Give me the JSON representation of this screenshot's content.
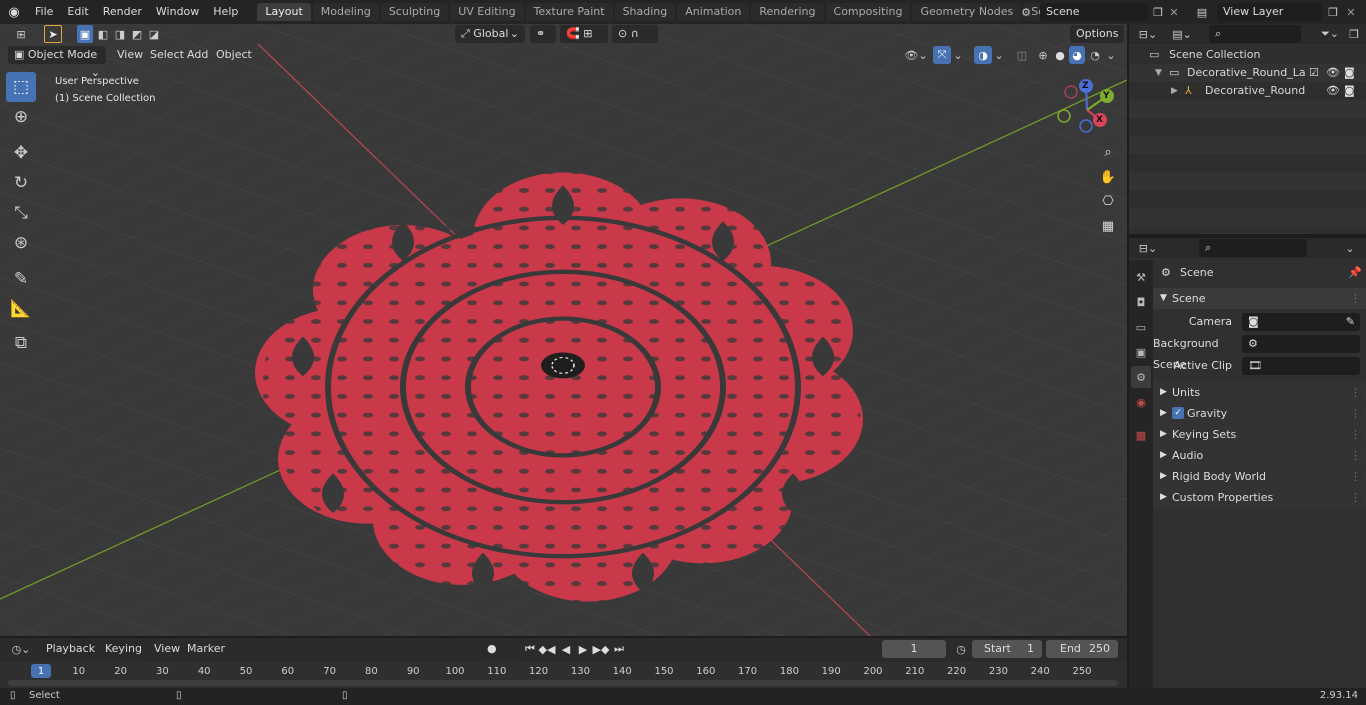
{
  "app": {
    "menus": [
      "File",
      "Edit",
      "Render",
      "Window",
      "Help"
    ],
    "workspaces": [
      "Layout",
      "Modeling",
      "Sculpting",
      "UV Editing",
      "Texture Paint",
      "Shading",
      "Animation",
      "Rendering",
      "Compositing",
      "Geometry Nodes",
      "Scripting"
    ],
    "active_workspace": "Layout",
    "scene_name": "Scene",
    "view_layer": "View Layer",
    "version": "2.93.14"
  },
  "viewport": {
    "mode": "Object Mode",
    "menus": [
      "View",
      "Select",
      "Add",
      "Object"
    ],
    "transform_orientation": "Global",
    "options_label": "Options",
    "perspective_label": "User Perspective",
    "collection_label": "(1) Scene Collection",
    "gizmo": {
      "z": "Z",
      "y": "Y",
      "x": "X"
    }
  },
  "outliner": {
    "root": "Scene Collection",
    "items": [
      {
        "label": "Decorative_Round_Lace_Pape"
      },
      {
        "label": "Decorative_Round_Lace_"
      }
    ]
  },
  "properties": {
    "context": "Scene",
    "panel_title": "Scene",
    "fields": [
      {
        "label": "Camera",
        "value": ""
      },
      {
        "label": "Background Scene",
        "value": ""
      },
      {
        "label": "Active Clip",
        "value": ""
      }
    ],
    "subpanels": [
      "Units",
      "Gravity",
      "Keying Sets",
      "Audio",
      "Rigid Body World",
      "Custom Properties"
    ],
    "gravity_checked": true
  },
  "timeline": {
    "menus": [
      "Playback",
      "Keying",
      "View",
      "Marker"
    ],
    "current_frame": "1",
    "start_label": "Start",
    "start": "1",
    "end_label": "End",
    "end": "250",
    "ticks": [
      "1",
      "10",
      "20",
      "30",
      "40",
      "50",
      "60",
      "70",
      "80",
      "90",
      "100",
      "110",
      "120",
      "130",
      "140",
      "150",
      "160",
      "170",
      "180",
      "190",
      "200",
      "210",
      "220",
      "230",
      "240",
      "250"
    ]
  },
  "status": {
    "select_label": "Select"
  },
  "colors": {
    "accent": "#4772b3",
    "lace": "#cc3a4a",
    "x_axis": "#c5414c",
    "y_axis": "#6f9a2a"
  }
}
